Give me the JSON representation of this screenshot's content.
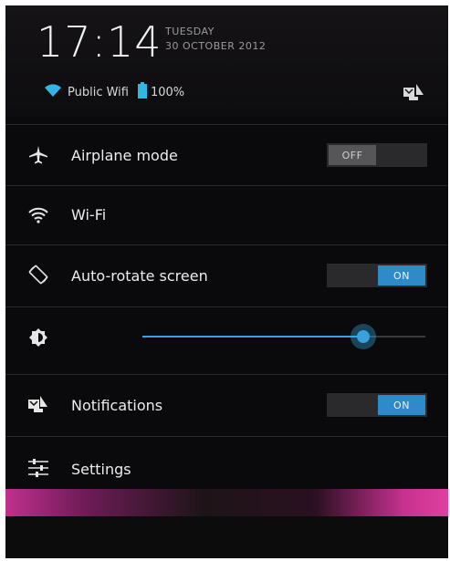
{
  "header": {
    "time": "17:14",
    "day": "TUESDAY",
    "date": "30 OCTOBER 2012",
    "network_name": "Public Wifi",
    "battery_level": "100%",
    "battery_fraction": 1.0
  },
  "quick_settings": {
    "airplane": {
      "label": "Airplane mode",
      "toggle": "OFF",
      "state": "off"
    },
    "wifi": {
      "label": "Wi-Fi"
    },
    "autorotate": {
      "label": "Auto-rotate screen",
      "toggle": "ON",
      "state": "on"
    },
    "brightness": {
      "level": 0.78
    },
    "notifications": {
      "label": "Notifications",
      "toggle": "ON",
      "state": "on"
    },
    "settings": {
      "label": "Settings"
    }
  },
  "colors": {
    "accent": "#33b5e5",
    "toggle_on": "#2e8ac9",
    "toggle_off": "#565658",
    "background": "#0a0a0c"
  },
  "icons": [
    "wifi-icon",
    "battery-icon",
    "notifications-shortcut-icon",
    "airplane-icon",
    "wifi-icon",
    "rotate-icon",
    "brightness-icon",
    "notifications-icon",
    "settings-sliders-icon"
  ]
}
